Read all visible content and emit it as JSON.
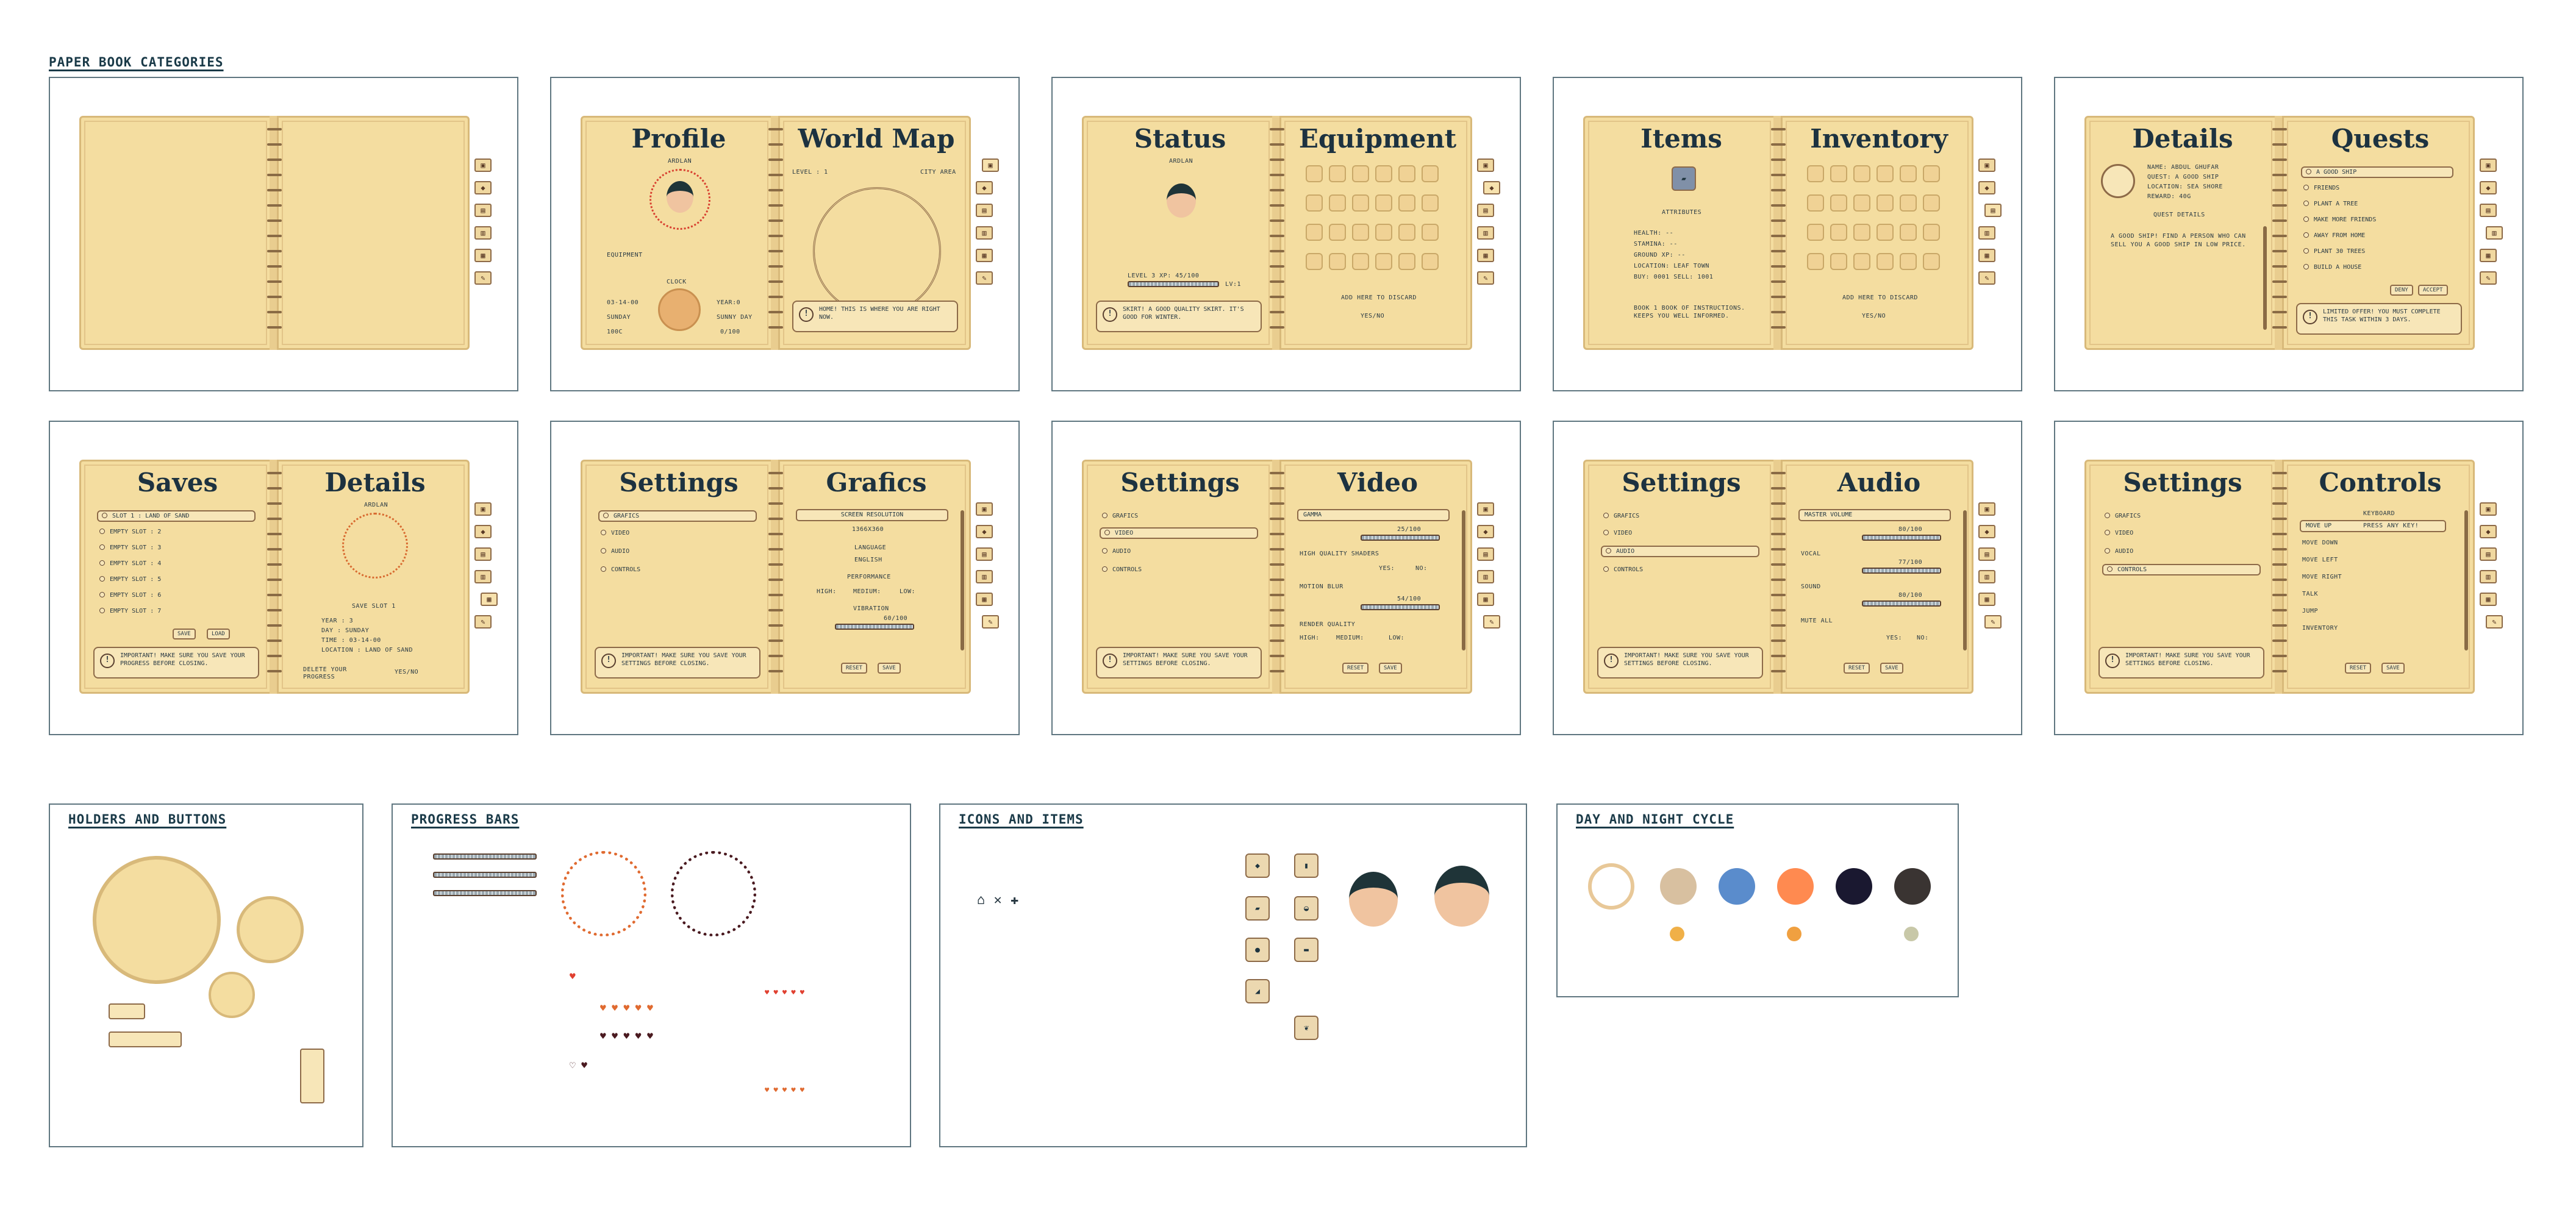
{
  "sections": {
    "paper_book_categories": "PAPER BOOK CATEGORIES",
    "holders_and_buttons": "HOLDERS AND BUTTONS",
    "progress_bars": "PROGRESS BARS",
    "icons_and_items": "ICONS AND ITEMS",
    "day_and_night_cycle": "DAY AND NIGHT CYCLE"
  },
  "profile": {
    "left_title": "Profile",
    "right_title": "World Map",
    "name": "ARDLAN",
    "equipment": "EQUIPMENT",
    "clock": "CLOCK",
    "date": "03-14-00",
    "year": "YEAR:0",
    "day": "SUNDAY",
    "weather": "SUNNY DAY",
    "temp": "100C",
    "progress": "0/100",
    "level": "LEVEL : 1",
    "area": "CITY AREA",
    "home_notice": "HOME! THIS IS WHERE YOU ARE RIGHT NOW."
  },
  "status": {
    "left_title": "Status",
    "right_title": "Equipment",
    "name": "ARDLAN",
    "level": "LEVEL 3  XP: 45/100",
    "lvl": "LV:1",
    "item_notice": "SKIRT! A GOOD QUALITY SKIRT. IT'S GOOD FOR WINTER.",
    "discard": "ADD HERE TO DISCARD",
    "confirm": "YES/NO"
  },
  "items": {
    "left_title": "Items",
    "right_title": "Inventory",
    "attributes": "ATTRIBUTES",
    "stats": [
      "HEALTH: --",
      "STAMINA: --",
      "GROUND XP: --",
      "LOCATION: LEAF TOWN",
      "BUY: 0001  SELL: 1001"
    ],
    "book_notice": "BOOK 1 BOOK OF INSTRUCTIONS. KEEPS YOU WELL INFORMED.",
    "discard": "ADD HERE TO DISCARD",
    "confirm": "YES/NO"
  },
  "details_quests": {
    "left_title": "Details",
    "right_title": "Quests",
    "info": [
      "NAME: ABDUL GHUFAR",
      "QUEST: A GOOD SHIP",
      "LOCATION: SEA SHORE",
      "REWARD: 40G"
    ],
    "quest_details": "QUEST DETAILS",
    "quest_text": "A GOOD SHIP! FIND A PERSON WHO CAN SELL YOU A GOOD SHIP IN LOW PRICE.",
    "quests": [
      "A GOOD SHIP",
      "FRIENDS",
      "PLANT A TREE",
      "MAKE MORE FRIENDS",
      "AWAY FROM HOME",
      "PLANT 30 TREES",
      "BUILD A HOUSE"
    ],
    "deny": "DENY",
    "accept": "ACCEPT",
    "offer_notice": "LIMITED OFFER! YOU MUST COMPLETE THIS TASK WITHIN 3 DAYS."
  },
  "saves": {
    "left_title": "Saves",
    "right_title": "Details",
    "slots": [
      "SLOT 1 : LAND OF SAND",
      "EMPTY SLOT : 2",
      "EMPTY SLOT : 3",
      "EMPTY SLOT : 4",
      "EMPTY SLOT : 5",
      "EMPTY SLOT : 6",
      "EMPTY SLOT : 7"
    ],
    "save": "SAVE",
    "load": "LOAD",
    "notice": "IMPORTANT! MAKE SURE YOU SAVE YOUR PROGRESS BEFORE CLOSING.",
    "name": "ARDLAN",
    "save_slot": "SAVE SLOT 1",
    "info": [
      "YEAR : 3",
      "DAY : SUNDAY",
      "TIME : 03-14-00",
      "LOCATION : LAND OF SAND"
    ],
    "delete": "DELETE YOUR PROGRESS",
    "confirm": "YES/NO"
  },
  "settings": {
    "title": "Settings",
    "menu": [
      "GRAFICS",
      "VIDEO",
      "AUDIO",
      "CONTROLS"
    ],
    "notice": "IMPORTANT! MAKE SURE YOU SAVE YOUR SETTINGS BEFORE CLOSING.",
    "reset": "RESET",
    "save": "SAVE"
  },
  "grafics": {
    "title": "Grafics",
    "resolution_label": "SCREEN RESOLUTION",
    "resolution": "1366X360",
    "language_label": "LANGUAGE",
    "language": "ENGLISH",
    "performance": "PERFORMANCE",
    "perf_opts": [
      "HIGH:",
      "MEDIUM:",
      "LOW:"
    ],
    "vibration": "VIBRATION",
    "vibration_val": "60/100"
  },
  "video": {
    "title": "Video",
    "gamma": "GAMMA",
    "gamma_val": "25/100",
    "shaders": "HIGH QUALITY SHADERS",
    "yes": "YES:",
    "no": "NO:",
    "motion": "MOTION BLUR",
    "motion_val": "54/100",
    "render": "RENDER QUALITY",
    "render_opts": [
      "HIGH:",
      "MEDIUM:",
      "LOW:"
    ]
  },
  "audio": {
    "title": "Audio",
    "master": "MASTER VOLUME",
    "master_val": "80/100",
    "vocal": "VOCAL",
    "vocal_val": "77/100",
    "sound": "SOUND",
    "sound_val": "80/100",
    "mute": "MUTE ALL",
    "yes": "YES:",
    "no": "NO:"
  },
  "controls": {
    "title": "Controls",
    "keyboard": "KEYBOARD",
    "press": "PRESS ANY KEY!",
    "actions": [
      "MOVE UP",
      "MOVE DOWN",
      "MOVE LEFT",
      "MOVE RIGHT",
      "TALK",
      "JUMP",
      "INVENTORY"
    ]
  },
  "colors": {
    "paper": "#f4dda0",
    "ink": "#1d3240",
    "wood": "#8d6a48"
  }
}
